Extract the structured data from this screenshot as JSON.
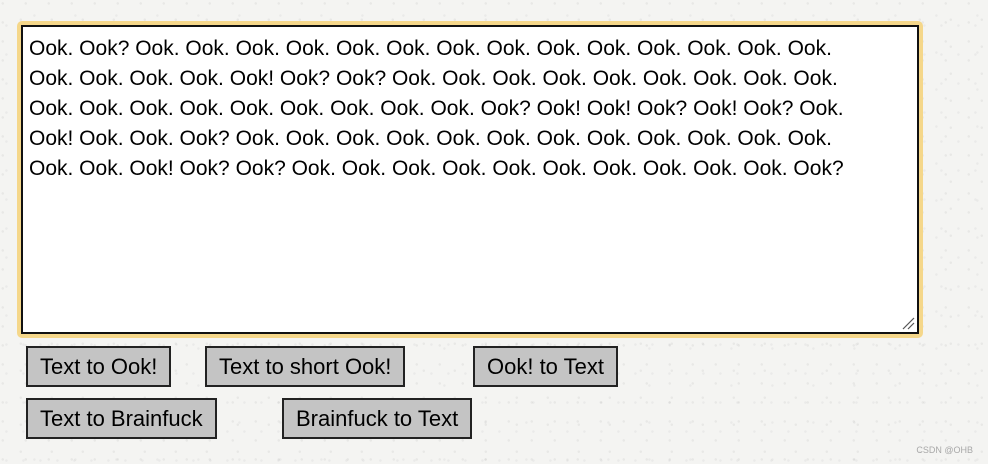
{
  "editor": {
    "value": "Ook. Ook? Ook. Ook. Ook. Ook. Ook. Ook. Ook. Ook. Ook. Ook. Ook. Ook. Ook. Ook.\nOok. Ook. Ook. Ook. Ook! Ook? Ook? Ook. Ook. Ook. Ook. Ook. Ook. Ook. Ook. Ook.\nOok. Ook. Ook. Ook. Ook. Ook. Ook. Ook. Ook. Ook? Ook! Ook! Ook? Ook! Ook? Ook.\nOok! Ook. Ook. Ook? Ook. Ook. Ook. Ook. Ook. Ook. Ook. Ook. Ook. Ook. Ook. Ook.\nOok. Ook. Ook! Ook? Ook? Ook. Ook. Ook. Ook. Ook. Ook. Ook. Ook. Ook. Ook. Ook?"
  },
  "buttons": {
    "text_to_ook": "Text to Ook!",
    "text_to_short_ook": "Text to short Ook!",
    "ook_to_text": "Ook! to Text",
    "text_to_brainfuck": "Text to Brainfuck",
    "brainfuck_to_text": "Brainfuck to Text"
  },
  "watermark": "CSDN @OHB",
  "colors": {
    "focus_ring": "#f5d78a",
    "button_bg": "#c4c4c4",
    "button_border": "#222222"
  }
}
